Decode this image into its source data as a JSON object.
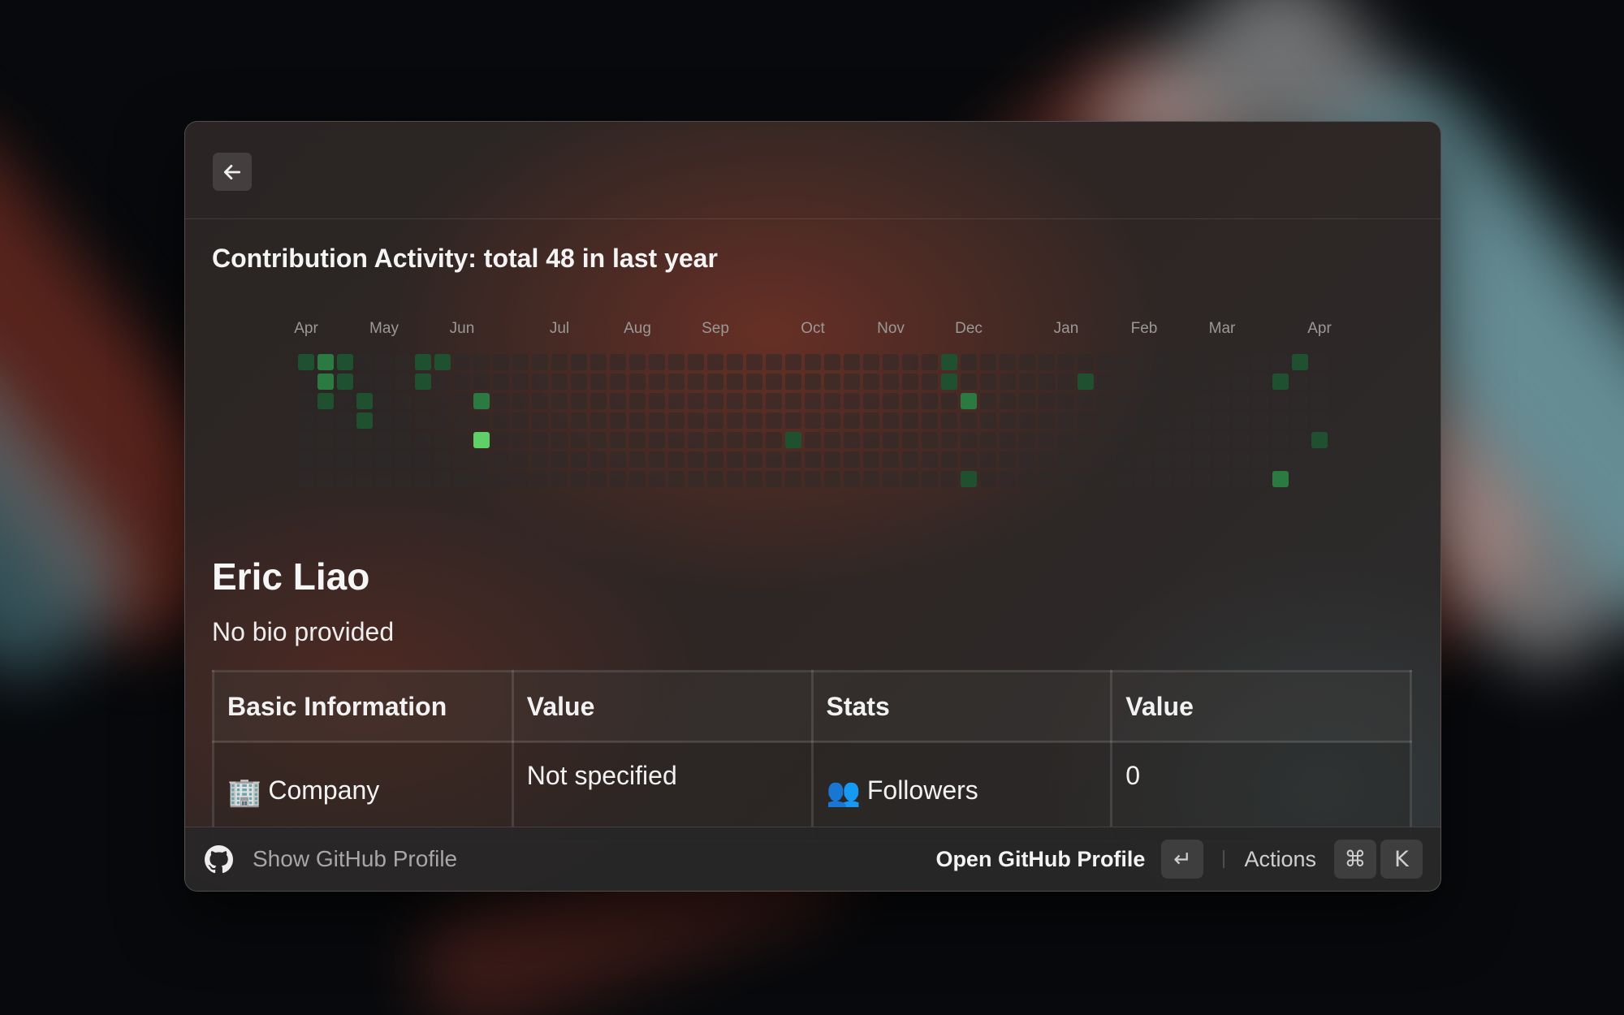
{
  "nav": {
    "back_icon": "arrow-left-icon"
  },
  "contribution": {
    "title": "Contribution Activity: total 48 in last year",
    "months": [
      "Apr",
      "May",
      "Jun",
      "Jul",
      "Aug",
      "Sep",
      "Oct",
      "Nov",
      "Dec",
      "Jan",
      "Feb",
      "Mar",
      "Apr"
    ],
    "month_columns": [
      0,
      4,
      8,
      13,
      17,
      21,
      26,
      30,
      34,
      39,
      43,
      47,
      52
    ],
    "weeks": 53,
    "days_per_week": 7,
    "cells": [
      {
        "week": 0,
        "day": 0,
        "level": 1
      },
      {
        "week": 1,
        "day": 0,
        "level": 2
      },
      {
        "week": 1,
        "day": 1,
        "level": 2
      },
      {
        "week": 1,
        "day": 2,
        "level": 1
      },
      {
        "week": 2,
        "day": 0,
        "level": 1
      },
      {
        "week": 2,
        "day": 1,
        "level": 1
      },
      {
        "week": 3,
        "day": 2,
        "level": 1
      },
      {
        "week": 3,
        "day": 3,
        "level": 1
      },
      {
        "week": 6,
        "day": 0,
        "level": 1
      },
      {
        "week": 6,
        "day": 1,
        "level": 1
      },
      {
        "week": 7,
        "day": 0,
        "level": 1
      },
      {
        "week": 9,
        "day": 2,
        "level": 2
      },
      {
        "week": 9,
        "day": 4,
        "level": 4
      },
      {
        "week": 25,
        "day": 4,
        "level": 1
      },
      {
        "week": 33,
        "day": 0,
        "level": 1
      },
      {
        "week": 33,
        "day": 1,
        "level": 1
      },
      {
        "week": 34,
        "day": 2,
        "level": 2
      },
      {
        "week": 34,
        "day": 6,
        "level": 1
      },
      {
        "week": 40,
        "day": 1,
        "level": 1
      },
      {
        "week": 50,
        "day": 1,
        "level": 1
      },
      {
        "week": 50,
        "day": 6,
        "level": 2
      },
      {
        "week": 51,
        "day": 0,
        "level": 1
      },
      {
        "week": 52,
        "day": 4,
        "level": 1
      }
    ],
    "level_colors": [
      "#2e2a29",
      "#1f5131",
      "#2b7a42",
      "#3aa352",
      "#5fd068"
    ]
  },
  "profile": {
    "name": "Eric Liao",
    "bio": "No bio provided"
  },
  "table": {
    "headers": [
      "Basic Information",
      "Value",
      "Stats",
      "Value"
    ],
    "rows": [
      {
        "info_emoji": "🏢",
        "info_label": "Company",
        "info_value": "Not specified",
        "stat_emoji": "👥",
        "stat_label": "Followers",
        "stat_value": "0"
      }
    ]
  },
  "footer": {
    "icon": "github-icon",
    "title": "Show GitHub Profile",
    "primary_action": "Open GitHub Profile",
    "enter_key": "↵",
    "actions_label": "Actions",
    "cmd_key": "⌘",
    "k_key": "K"
  }
}
